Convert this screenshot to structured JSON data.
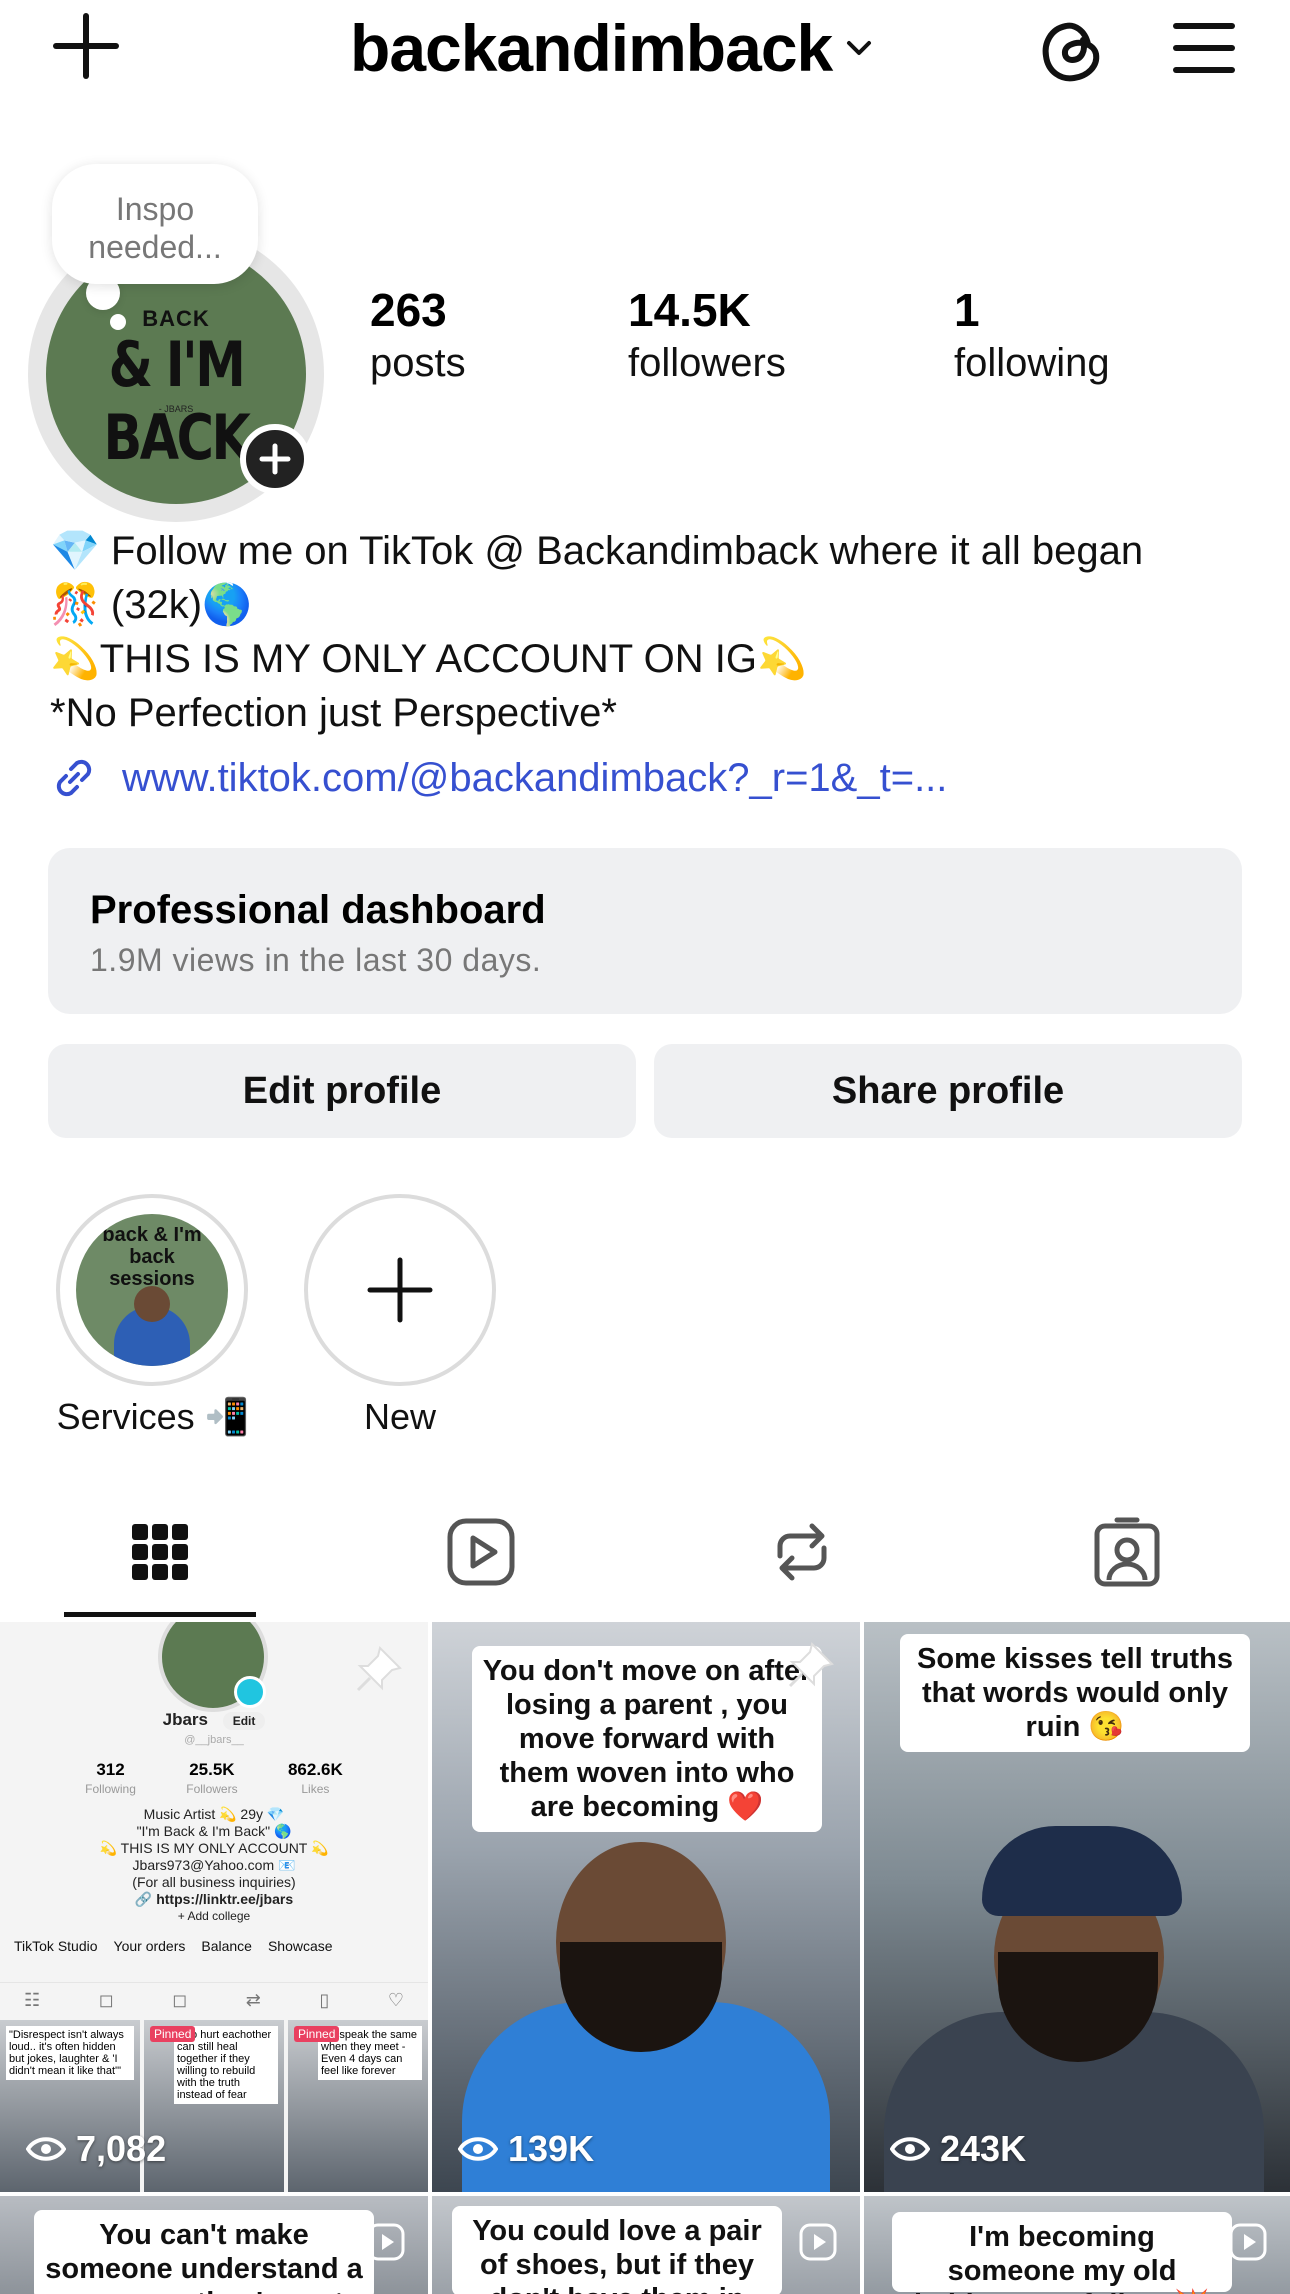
{
  "header": {
    "username": "backandimback"
  },
  "profile": {
    "bubble_note": "Inspo needed...",
    "avatar_text_line1": "BACK",
    "avatar_text_line2": "& I'M BACK",
    "avatar_text_line3": "- JBARS",
    "stats": [
      {
        "value": "263",
        "label": "posts"
      },
      {
        "value": "14.5K",
        "label": "followers"
      },
      {
        "value": "1",
        "label": "following"
      }
    ],
    "bio_lines": [
      "💎 Follow me on TikTok @ Backandimback where it all began",
      "🎊 (32k)🌎",
      "💫THIS IS MY ONLY ACCOUNT ON IG💫",
      "*No Perfection just Perspective*"
    ],
    "link": "www.tiktok.com/@backandimback?_r=1&_t=..."
  },
  "dashboard": {
    "title": "Professional dashboard",
    "subtitle": "1.9M views in the last 30 days."
  },
  "buttons": {
    "edit": "Edit profile",
    "share": "Share profile"
  },
  "highlights": [
    {
      "label": "Services 📲",
      "cover_text": "back & I'm back sessions"
    },
    {
      "label": "New"
    }
  ],
  "tabs": [
    "posts-grid",
    "reels",
    "reposts",
    "tagged"
  ],
  "posts": [
    {
      "views": "7,082",
      "mini_profile": {
        "name": "Jbars",
        "handle": "@__jbars__",
        "edit": "Edit",
        "stats": [
          {
            "value": "312",
            "label": "Following"
          },
          {
            "value": "25.5K",
            "label": "Followers"
          },
          {
            "value": "862.6K",
            "label": "Likes"
          }
        ],
        "bio": [
          "Music Artist 💫 29y 💎",
          "\"I'm Back & I'm Back\" 🌎",
          "💫 THIS IS MY ONLY ACCOUNT 💫",
          "Jbars973@Yahoo.com 📧",
          "(For all business inquiries)",
          "🔗 https://linktr.ee/jbars",
          "+ Add college"
        ],
        "links": [
          "TikTok Studio",
          "Your orders",
          "Balance",
          "Showcase"
        ],
        "thumbs": [
          {
            "tag": "",
            "text": "\"Disrespect isn't always loud.. it's often hidden but jokes, laughter & 'I didn't mean it like that'\""
          },
          {
            "tag": "Pinned",
            "text": "Two hurt eachother can still heal together if they willing to rebuild with the truth instead of fear"
          },
          {
            "tag": "Pinned",
            "text": "..to speak the same when they meet - Even 4 days can feel like forever"
          }
        ]
      }
    },
    {
      "views": "139K",
      "caption": "You don't move on after losing a parent , you move forward with them woven into who are becoming ❤️"
    },
    {
      "views": "243K",
      "caption": "Some kisses tell truths that words would only ruin 😘"
    },
    {
      "caption": "You can't make someone understand a message they're not ready to receive"
    },
    {
      "caption": "You could love a pair of shoes, but if they don't have them in your size, you have to"
    },
    {
      "caption": "I'm becoming someone my old habits can't follow 💥"
    }
  ]
}
